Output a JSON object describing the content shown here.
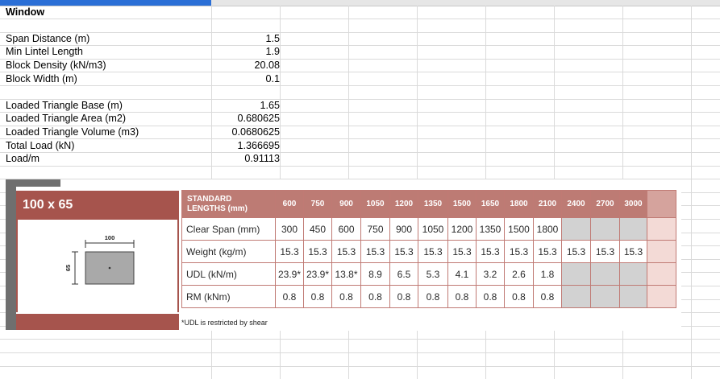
{
  "sheet": {
    "title": "Window",
    "inputs": [
      {
        "label": "Span Distance (m)",
        "value": "1.5"
      },
      {
        "label": "Min Lintel Length",
        "value": "1.9"
      },
      {
        "label": "Block Density (kN/m3)",
        "value": "20.08"
      },
      {
        "label": "Block Width (m)",
        "value": "0.1"
      }
    ],
    "calcs": [
      {
        "label": "Loaded Triangle Base (m)",
        "value": "1.65"
      },
      {
        "label": "Loaded Triangle Area (m2)",
        "value": "0.680625"
      },
      {
        "label": "Loaded Triangle Volume (m3)",
        "value": "0.0680625"
      },
      {
        "label": "Total Load (kN)",
        "value": "1.366695"
      },
      {
        "label": "Load/m",
        "value": "0.91113"
      }
    ]
  },
  "lintel": {
    "size": "100 x 65",
    "width_dim": "100",
    "height_dim": "65",
    "note": "*UDL is restricted by shear",
    "header": {
      "line1": "STANDARD",
      "line2": "LENGTHS (mm)",
      "lengths": [
        "600",
        "750",
        "900",
        "1050",
        "1200",
        "1350",
        "1500",
        "1650",
        "1800",
        "2100",
        "2400",
        "2700",
        "3000"
      ]
    },
    "rows": [
      {
        "label": "Clear Span (mm)",
        "values": [
          "300",
          "450",
          "600",
          "750",
          "900",
          "1050",
          "1200",
          "1350",
          "1500",
          "1800",
          "",
          "",
          ""
        ]
      },
      {
        "label": "Weight (kg/m)",
        "values": [
          "15.3",
          "15.3",
          "15.3",
          "15.3",
          "15.3",
          "15.3",
          "15.3",
          "15.3",
          "15.3",
          "15.3",
          "15.3",
          "15.3",
          "15.3"
        ]
      },
      {
        "label": "UDL (kN/m)",
        "values": [
          "23.9*",
          "23.9*",
          "13.8*",
          "8.9",
          "6.5",
          "5.3",
          "4.1",
          "3.2",
          "2.6",
          "1.8",
          "",
          "",
          ""
        ]
      },
      {
        "label": "RM (kNm)",
        "values": [
          "0.8",
          "0.8",
          "0.8",
          "0.8",
          "0.8",
          "0.8",
          "0.8",
          "0.8",
          "0.8",
          "0.8",
          "",
          "",
          ""
        ]
      }
    ]
  }
}
